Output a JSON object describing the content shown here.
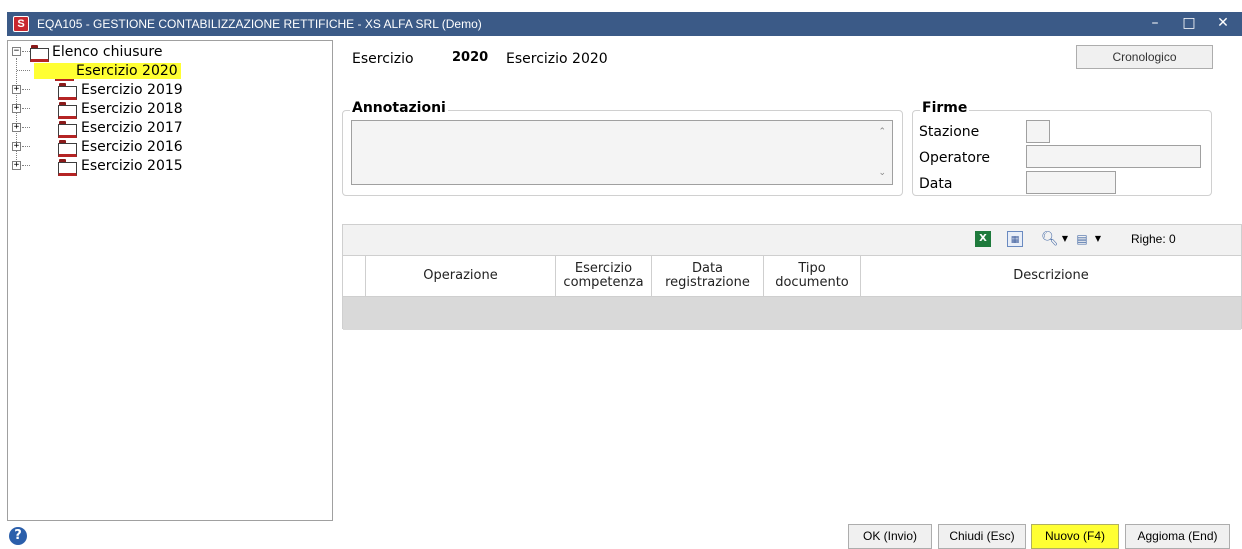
{
  "window": {
    "title": "EQA105 - GESTIONE CONTABILIZZAZIONE RETTIFICHE - XS ALFA SRL  (Demo)",
    "app_icon_letter": "S",
    "minimize_glyph": "–",
    "maximize_glyph": "□",
    "close_glyph": "✕"
  },
  "tree": {
    "root_label": "Elenco chiusure",
    "items": [
      {
        "label": "Esercizio 2020",
        "selected": true
      },
      {
        "label": "Esercizio 2019"
      },
      {
        "label": "Esercizio 2018"
      },
      {
        "label": "Esercizio 2017"
      },
      {
        "label": "Esercizio 2016"
      },
      {
        "label": "Esercizio 2015"
      }
    ]
  },
  "form": {
    "esercizio_label": "Esercizio",
    "esercizio_value": "2020",
    "esercizio_desc": "Esercizio 2020",
    "cronologico_button": "Cronologico",
    "annotazioni_title": "Annotazioni",
    "firme_title": "Firme",
    "stazione_label": "Stazione",
    "operatore_label": "Operatore",
    "data_label": "Data"
  },
  "grid": {
    "righe_label": "Righe: 0",
    "columns": [
      {
        "line1": "Operazione",
        "line2": ""
      },
      {
        "line1": "Esercizio",
        "line2": "competenza"
      },
      {
        "line1": "Data",
        "line2": "registrazione"
      },
      {
        "line1": "Tipo",
        "line2": "documento"
      },
      {
        "line1": "Descrizione",
        "line2": ""
      }
    ]
  },
  "footer": {
    "help_glyph": "?",
    "ok_button": "OK (Invio)",
    "chiudi_button": "Chiudi (Esc)",
    "nuovo_button": "Nuovo (F4)",
    "aggiorna_button": "Aggioma (End)"
  },
  "colors": {
    "titlebar": "#3b5a87",
    "highlight": "#ffff33"
  }
}
